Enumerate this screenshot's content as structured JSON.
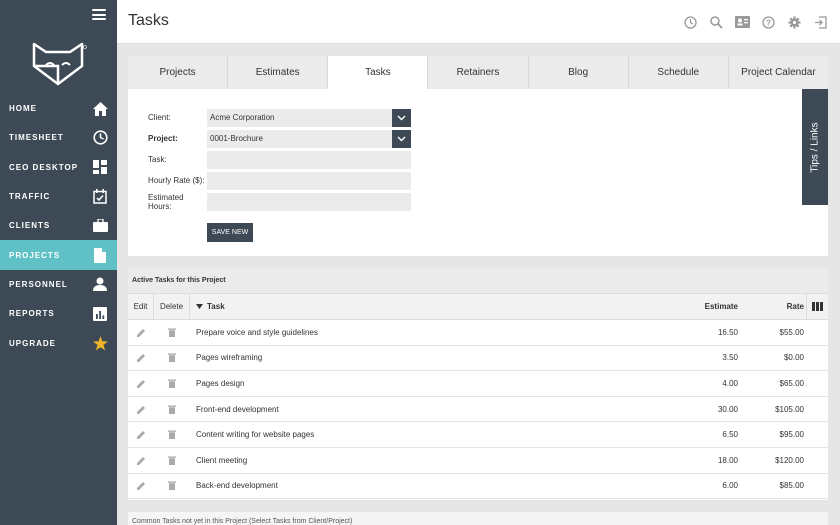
{
  "app": {
    "page_title": "Tasks"
  },
  "sidebar": {
    "items": [
      {
        "label": "HOME",
        "icon": "home-icon"
      },
      {
        "label": "TIMESHEET",
        "icon": "clock-icon"
      },
      {
        "label": "CEO DESKTOP",
        "icon": "dashboard-icon"
      },
      {
        "label": "TRAFFIC",
        "icon": "calendar-check-icon"
      },
      {
        "label": "CLIENTS",
        "icon": "briefcase-icon"
      },
      {
        "label": "PROJECTS",
        "icon": "document-icon",
        "active": true
      },
      {
        "label": "PERSONNEL",
        "icon": "person-icon"
      },
      {
        "label": "REPORTS",
        "icon": "bar-chart-icon"
      },
      {
        "label": "UPGRADE",
        "icon": "star-icon"
      }
    ]
  },
  "header_icons": [
    "clock-icon",
    "search-icon",
    "contact-card-icon",
    "help-icon",
    "gear-icon",
    "logout-icon"
  ],
  "tabs": [
    {
      "label": "Projects"
    },
    {
      "label": "Estimates"
    },
    {
      "label": "Tasks",
      "active": true
    },
    {
      "label": "Retainers"
    },
    {
      "label": "Blog"
    },
    {
      "label": "Schedule"
    },
    {
      "label": "Project Calendar"
    }
  ],
  "form": {
    "client_label": "Client:",
    "client_value": "Acme Corporation",
    "project_label": "Project:",
    "project_value": "0001-Brochure",
    "task_label": "Task:",
    "task_value": "",
    "rate_label": "Hourly Rate ($):",
    "rate_value": "",
    "hours_label": "Estimated Hours:",
    "hours_value": "",
    "save_label": "SAVE NEW"
  },
  "tips_label": "Tips / Links",
  "table": {
    "title": "Active Tasks for this Project",
    "headers": {
      "edit": "Edit",
      "delete": "Delete",
      "task": "Task",
      "estimate": "Estimate",
      "rate": "Rate"
    },
    "rows": [
      {
        "task": "Prepare voice and style guidelines",
        "estimate": "16.50",
        "rate": "$55.00"
      },
      {
        "task": "Pages wireframing",
        "estimate": "3.50",
        "rate": "$0.00"
      },
      {
        "task": "Pages design",
        "estimate": "4.00",
        "rate": "$65.00"
      },
      {
        "task": "Front-end development",
        "estimate": "30.00",
        "rate": "$105.00"
      },
      {
        "task": "Content writing for website pages",
        "estimate": "6.50",
        "rate": "$95.00"
      },
      {
        "task": "Client meeting",
        "estimate": "18.00",
        "rate": "$120.00"
      },
      {
        "task": "Back-end development",
        "estimate": "6.00",
        "rate": "$85.00"
      }
    ]
  },
  "bottom_text": "Common Tasks not yet in this Project (Select Tasks from Client/Project)",
  "colors": {
    "sidebar": "#3d4a56",
    "active": "#5fc1c5",
    "star": "#f0b429"
  }
}
